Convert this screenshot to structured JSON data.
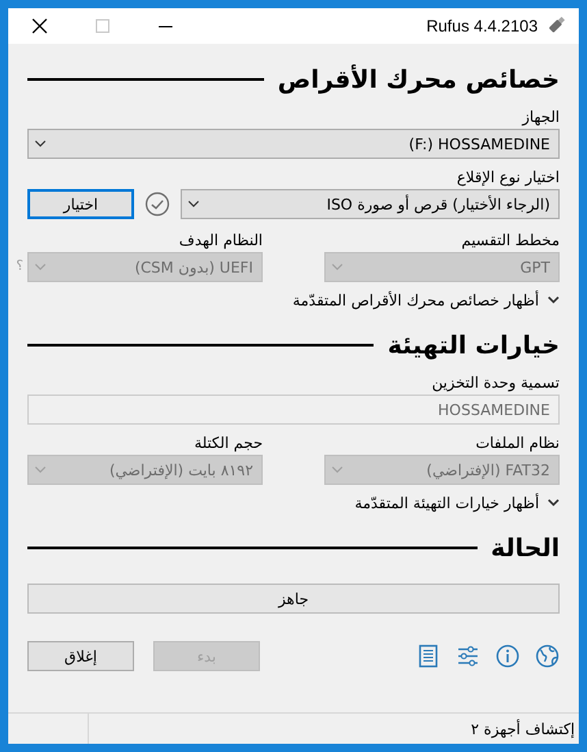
{
  "window": {
    "title": "Rufus 4.4.2103"
  },
  "drive_properties": {
    "heading": "خصائص محرك الأقراص",
    "device": {
      "label": "الجهاز",
      "value": "(F:) HOSSAMEDINE",
      "disabled": false
    },
    "boot_selection": {
      "label": "اختيار نوع الإقلاع",
      "value": "(الرجاء الأختيار) قرص أو صورة ISO",
      "disabled": false
    },
    "select_button": {
      "label": "اختيار",
      "disabled": false
    },
    "partition_scheme": {
      "label": "مخطط التقسيم",
      "value": "GPT",
      "disabled": true
    },
    "target_system": {
      "label": "النظام الهدف",
      "value": "UEFI (بدون CSM)",
      "disabled": true
    },
    "help": "؟",
    "advanced_toggle": {
      "label": "أظهار خصائص محرك الأقراص المتقدّمة",
      "expanded": false
    }
  },
  "format_options": {
    "heading": "خيارات التهيئة",
    "volume_label": {
      "label": "تسمية وحدة التخزين",
      "value": "HOSSAMEDINE",
      "disabled": true
    },
    "file_system": {
      "label": "نظام الملفات",
      "value": "FAT32 (الإفتراضي)",
      "disabled": true
    },
    "cluster_size": {
      "label": "حجم الكتلة",
      "value": "٨١٩٢ بايت (الإفتراضي)",
      "disabled": true
    },
    "advanced_toggle": {
      "label": "أظهار خيارات التهيئة المتقدّمة",
      "expanded": false
    }
  },
  "status": {
    "heading": "الحالة",
    "progress": {
      "text": "جاهز",
      "level": 0
    },
    "start_button": {
      "label": "بدء",
      "disabled": true
    },
    "close_button": {
      "label": "إغلاق",
      "disabled": false
    }
  },
  "status_bar": {
    "text": "إكتشاف أجهزة ٢"
  }
}
